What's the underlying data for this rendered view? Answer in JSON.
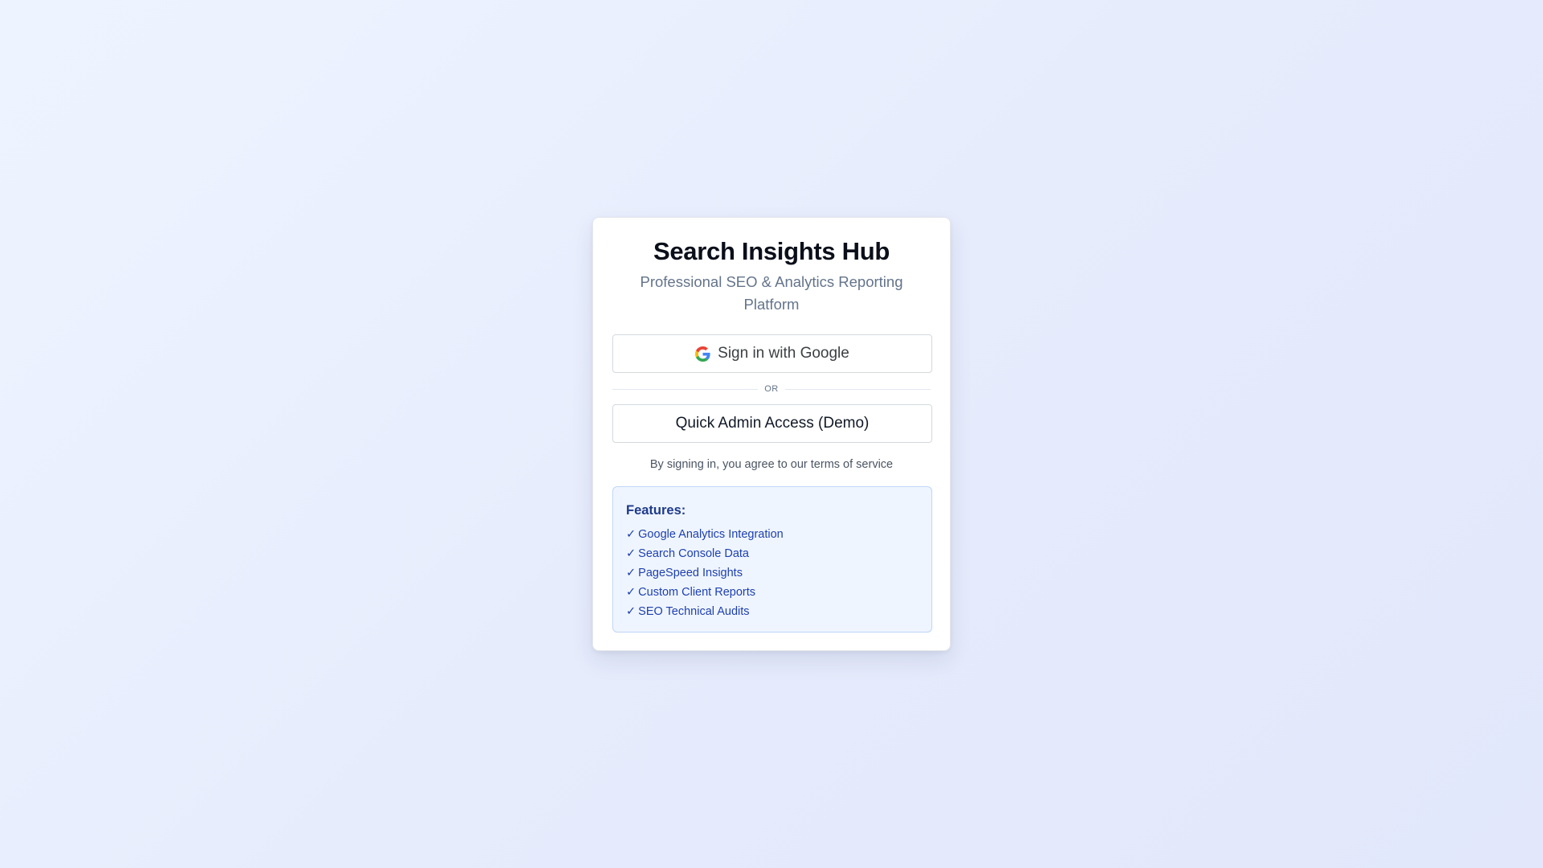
{
  "app": {
    "title": "Search Insights Hub",
    "subtitle": "Professional SEO & Analytics Reporting Platform"
  },
  "auth": {
    "google_button_label": "Sign in with Google",
    "google_icon": "google-g-logo",
    "divider_label": "OR",
    "admin_button_label": "Quick Admin Access (Demo)",
    "terms_text": "By signing in, you agree to our terms of service"
  },
  "features": {
    "title": "Features:",
    "check_glyph": "✓",
    "items": [
      "Google Analytics Integration",
      "Search Console Data",
      "PageSpeed Insights",
      "Custom Client Reports",
      "SEO Technical Audits"
    ]
  },
  "colors": {
    "background": "#e8eefc",
    "card": "#ffffff",
    "features_bg": "#eff5ff",
    "features_border": "#bfd6f6",
    "features_text": "#1e40af",
    "google_blue": "#4285F4",
    "google_red": "#EA4335",
    "google_yellow": "#FBBC05",
    "google_green": "#34A853"
  }
}
